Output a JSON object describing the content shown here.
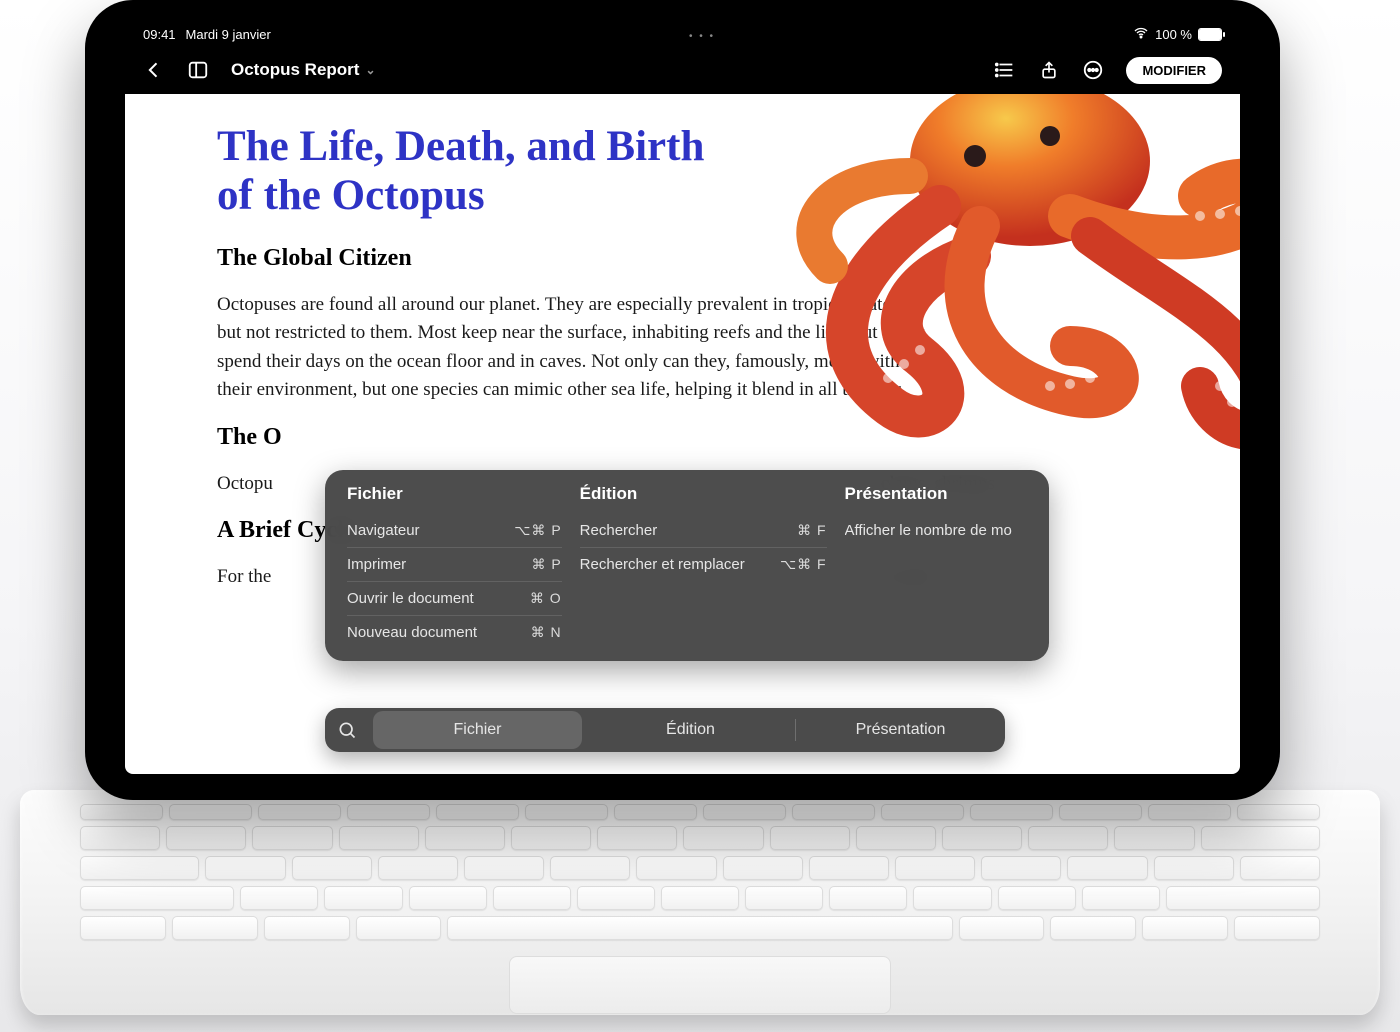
{
  "status": {
    "time": "09:41",
    "date": "Mardi 9 janvier",
    "battery_pct_label": "100 %",
    "battery_fill": 100
  },
  "toolbar": {
    "doc_title": "Octopus Report",
    "modify_label": "MODIFIER"
  },
  "document": {
    "title": "The Life, Death, and Birth of the Octopus",
    "sections": [
      {
        "heading": "The Global Citizen",
        "body": "Octopuses are found all around our planet. They are especially prevalent in tropical waters, but not restricted to them. Most keep near the surface, inhabiting reefs and the like, but many spend their days on the ocean floor and in caves. Not only can they, famously, merge with their environment, but one species can mimic other sea life, helping it blend in all the mor"
      },
      {
        "heading": "The O",
        "body": "Octopu                                                                                                                                clams, shrimps                                                                                                                               devour                                                                                                                                and two leg"
      },
      {
        "heading": "A Brief Cycle",
        "body": "For the                                                                                                                                st male"
      }
    ]
  },
  "hud": {
    "columns": [
      {
        "title": "Fichier",
        "items": [
          {
            "label": "Navigateur",
            "shortcut": "⌥⌘ P"
          },
          {
            "label": "Imprimer",
            "shortcut": "⌘ P"
          },
          {
            "label": "Ouvrir le document",
            "shortcut": "⌘ O"
          },
          {
            "label": "Nouveau document",
            "shortcut": "⌘ N"
          }
        ]
      },
      {
        "title": "Édition",
        "items": [
          {
            "label": "Rechercher",
            "shortcut": "⌘ F"
          },
          {
            "label": "Rechercher et remplacer",
            "shortcut": "⌥⌘ F"
          }
        ]
      },
      {
        "title": "Présentation",
        "items": [
          {
            "label": "Afficher le nombre de mo",
            "shortcut": ""
          }
        ]
      }
    ],
    "tabs": {
      "fichier": "Fichier",
      "edition": "Édition",
      "presentation": "Présentation"
    }
  }
}
